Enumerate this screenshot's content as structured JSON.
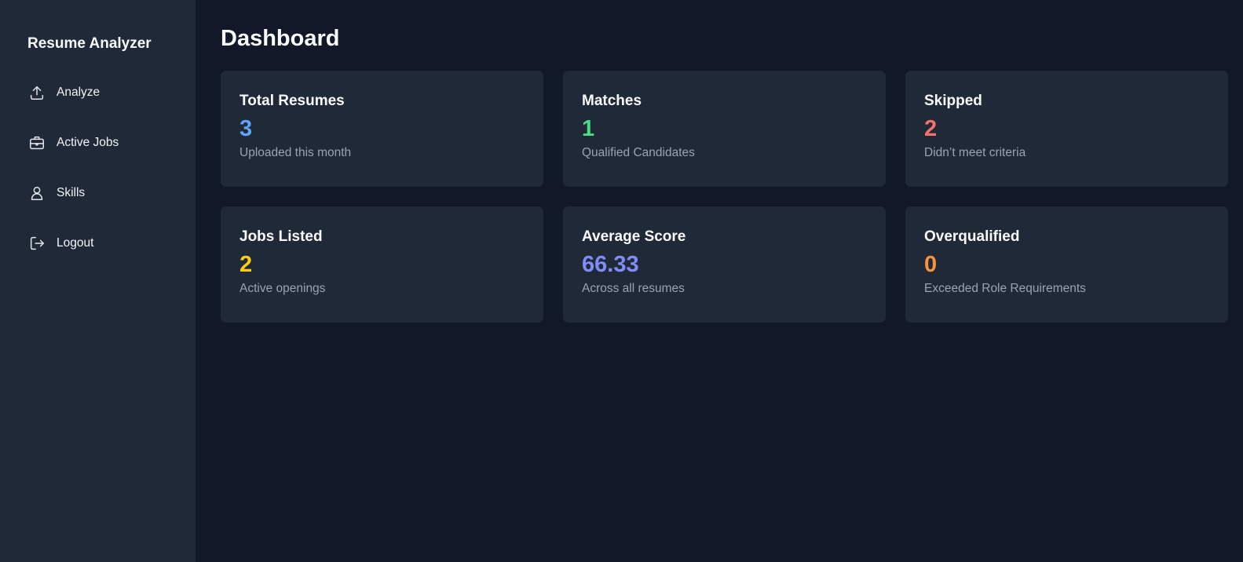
{
  "sidebar": {
    "brand": "Resume Analyzer",
    "items": [
      {
        "label": "Analyze",
        "icon": "upload-icon"
      },
      {
        "label": "Active Jobs",
        "icon": "briefcase-icon"
      },
      {
        "label": "Skills",
        "icon": "user-icon"
      },
      {
        "label": "Logout",
        "icon": "logout-icon"
      }
    ]
  },
  "main": {
    "title": "Dashboard",
    "cards": [
      {
        "title": "Total Resumes",
        "value": "3",
        "subtitle": "Uploaded this month",
        "color": "#60a5fa"
      },
      {
        "title": "Matches",
        "value": "1",
        "subtitle": "Qualified Candidates",
        "color": "#4ade80"
      },
      {
        "title": "Skipped",
        "value": "2",
        "subtitle": "Didn’t meet criteria",
        "color": "#f87171"
      },
      {
        "title": "Jobs Listed",
        "value": "2",
        "subtitle": "Active openings",
        "color": "#facc15"
      },
      {
        "title": "Average Score",
        "value": "66.33",
        "subtitle": "Across all resumes",
        "color": "#818cf8"
      },
      {
        "title": "Overqualified",
        "value": "0",
        "subtitle": "Exceeded Role Requirements",
        "color": "#fb923c"
      }
    ]
  },
  "theme": {
    "background": "#111827",
    "panel": "#1f2937",
    "muted_text": "#9ca3af"
  }
}
